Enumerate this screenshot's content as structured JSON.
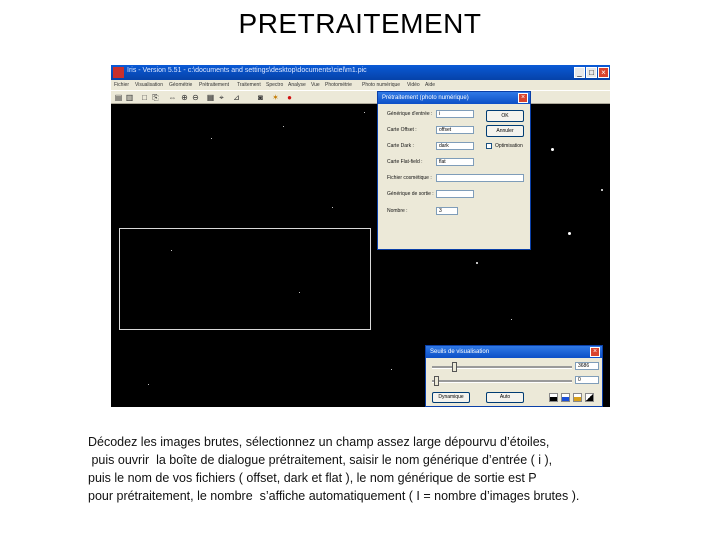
{
  "slide": {
    "title": "PRETRAITEMENT",
    "body_lines": [
      "Décodez les images brutes, sélectionnez un champ assez large dépourvu d’étoiles,",
      " puis ouvrir  la boîte de dialogue prétraitement, saisir le nom générique d’entrée ( i ),",
      "puis le nom de vos fichiers ( offset, dark et flat ), le nom générique de sortie est P",
      "pour prétraitement, le nombre  s’affiche automatiquement ( I = nombre d’images brutes )."
    ]
  },
  "app": {
    "title": "Iris - Version 5.51 - c:\\documents and settings\\desktop\\documents\\ciel\\m1.pic",
    "window_buttons": [
      "_",
      "□",
      "×"
    ],
    "menu": [
      "Fichier",
      "Visualisation",
      "Géométrie",
      "Prétraitement",
      "Traitement",
      "Spectro",
      "Analyse",
      "Vue",
      "Photométrie",
      "Photo numérique",
      "Vidéo",
      "Aide"
    ],
    "toolbar_icons": [
      "open-icon",
      "save-icon",
      "copy-icon",
      "paste-icon",
      "zoom-fit-icon",
      "zoom-in-icon",
      "zoom-out-icon",
      "grid-icon",
      "crosshair-icon",
      "measure-icon",
      "camera-icon",
      "palette-icon",
      "record-icon"
    ],
    "toolbar_glyphs": [
      "▤",
      "▥",
      "□",
      "⎘",
      "⇔",
      "⊕",
      "⊖",
      "▦",
      "⌖",
      "⊿",
      "◙",
      "✶",
      "●"
    ]
  },
  "dialog_pretraitement": {
    "title": "Prétraitement (photo numérique)",
    "close_label": "×",
    "fields": [
      {
        "label": "Générique d'entrée :",
        "value": "i"
      },
      {
        "label": "Carte Offset :",
        "value": "offset"
      },
      {
        "label": "Carte Dark :",
        "value": "dark"
      },
      {
        "label": "Carte Flat-field :",
        "value": "flat"
      },
      {
        "label": "Fichier cosmétique :",
        "value": ""
      },
      {
        "label": "Générique de sortie :",
        "value": ""
      },
      {
        "label": "Nombre :",
        "value": "3"
      }
    ],
    "ok_label": "OK",
    "cancel_label": "Annuler",
    "optimization_label": "Optimisation"
  },
  "dialog_seuils": {
    "title": "Seuils de visualisation",
    "close_label": "×",
    "high_value": "3686",
    "low_value": "0",
    "dynamic_label": "Dynamique",
    "auto_label": "Auto"
  }
}
